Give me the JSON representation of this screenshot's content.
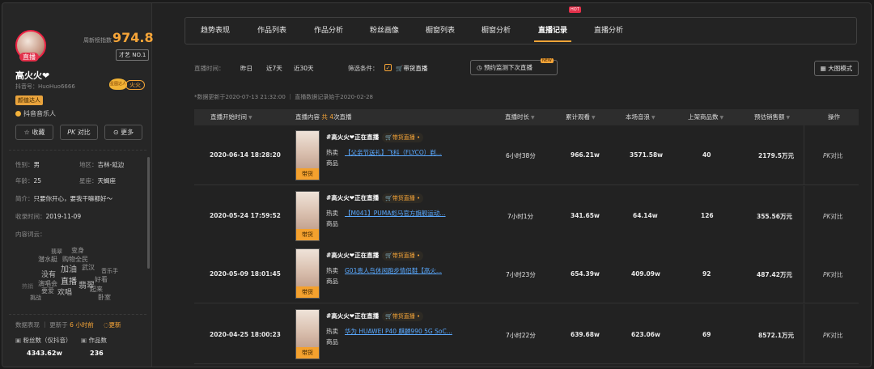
{
  "sidebar": {
    "avatar_badge": "直播",
    "score_label": "周新榜指数",
    "score": "974.8",
    "rank": "才艺 NO.1",
    "name": "高火火❤",
    "uid": "抖音号：HuoHuo6666",
    "tag": "颜值达人",
    "crown_text": "星图达人",
    "fire_tag": "火火",
    "category": "抖音音乐人",
    "buttons": {
      "favorite": "收藏",
      "compare": "对比",
      "more": "更多"
    },
    "gender_label": "性别：",
    "gender": "男",
    "region_label": "地区：",
    "region": "吉林-延边",
    "age_label": "年龄：",
    "age": "25",
    "zodiac_label": "星座：",
    "zodiac": "天蝎座",
    "intro_label": "简介：",
    "intro": "只要你开心，要我干嘛都好～",
    "record_label": "收录时间：",
    "record": "2019-11-09",
    "words_label": "内容词云：",
    "cloud_words": [
      "翡翠",
      "变身",
      "潜水艇",
      "购物全民",
      "加油",
      "武汉",
      "音乐手",
      "没有",
      "直播",
      "好看",
      "热销",
      "演唱会",
      "翡翠",
      "起来",
      "要爱",
      "欢唱",
      "挑战",
      "卧室"
    ],
    "update_label": "数据表现 ｜ 更新于",
    "update_time": "6 小时前",
    "update_btn": "更新",
    "fans_label": "粉丝数（仅抖音）",
    "works_label": "作品数",
    "fans": "4343.62w",
    "works": "236"
  },
  "tabs": [
    "趋势表现",
    "作品列表",
    "作品分析",
    "粉丝画像",
    "橱窗列表",
    "橱窗分析",
    "直播记录",
    "直播分析"
  ],
  "active_tab": "直播记录",
  "hot_badge": "HOT",
  "filters": {
    "time_label": "直播时间：",
    "time_options": [
      "昨日",
      "近7天",
      "近30天"
    ],
    "cond_label": "筛选条件：",
    "cond_option": "带货直播",
    "book_btn": "预约监测下次直播",
    "new_badge": "NEW",
    "big_btn": "大图模式"
  },
  "note": "*数据更新于2020-07-13 21:32:00 ｜ 直播数据记录始于2020-02-28",
  "table": {
    "headers": {
      "start": "直播开始时间",
      "content": "直播内容",
      "content_count_prefix": "共",
      "content_count": "4",
      "content_count_suffix": "次直播",
      "duration": "直播时长",
      "views": "累计观看",
      "sound": "本场音浪",
      "items": "上架商品数",
      "sales": "预估销售额",
      "op": "操作"
    },
    "rows": [
      {
        "start": "2020-06-14 18:28:20",
        "thumb_label": "带货",
        "title": "#高火火❤正在直播",
        "live_tag": "带货直播",
        "hot": "热卖",
        "product": "【父亲节送礼】飞科（FLYCO）剃...",
        "product_sub": "商品",
        "duration": "6小时38分",
        "views": "966.21w",
        "sound": "3571.58w",
        "items": "40",
        "sales": "2179.5万元",
        "op": "对比"
      },
      {
        "start": "2020-05-24 17:59:52",
        "thumb_label": "带货",
        "title": "#高火火❤正在直播",
        "live_tag": "带货直播",
        "hot": "热卖",
        "product": "【M041】PUMA彪马官方旗舰运动...",
        "product_sub": "商品",
        "duration": "7小时1分",
        "views": "341.65w",
        "sound": "64.14w",
        "items": "126",
        "sales": "355.56万元",
        "op": "对比"
      },
      {
        "start": "2020-05-09 18:01:45",
        "thumb_label": "带货",
        "title": "#高火火❤正在直播",
        "live_tag": "带货直播",
        "hot": "热卖",
        "product": "G01贵人鸟休闲跑步情侣鞋【高火...",
        "product_sub": "商品",
        "duration": "7小时23分",
        "views": "654.39w",
        "sound": "409.09w",
        "items": "92",
        "sales": "487.42万元",
        "op": "对比"
      },
      {
        "start": "2020-04-25 18:00:23",
        "thumb_label": "带货",
        "title": "#高火火❤正在直播",
        "live_tag": "带货直播",
        "hot": "热卖",
        "product": "华为 HUAWEI P40 麒麟990 5G SoC...",
        "product_sub": "商品",
        "duration": "7小时22分",
        "views": "639.68w",
        "sound": "623.06w",
        "items": "69",
        "sales": "8572.1万元",
        "op": "对比"
      }
    ]
  },
  "colors": {
    "accent": "#f7a538",
    "link": "#5aa9ff",
    "badge": "#e2304a"
  }
}
